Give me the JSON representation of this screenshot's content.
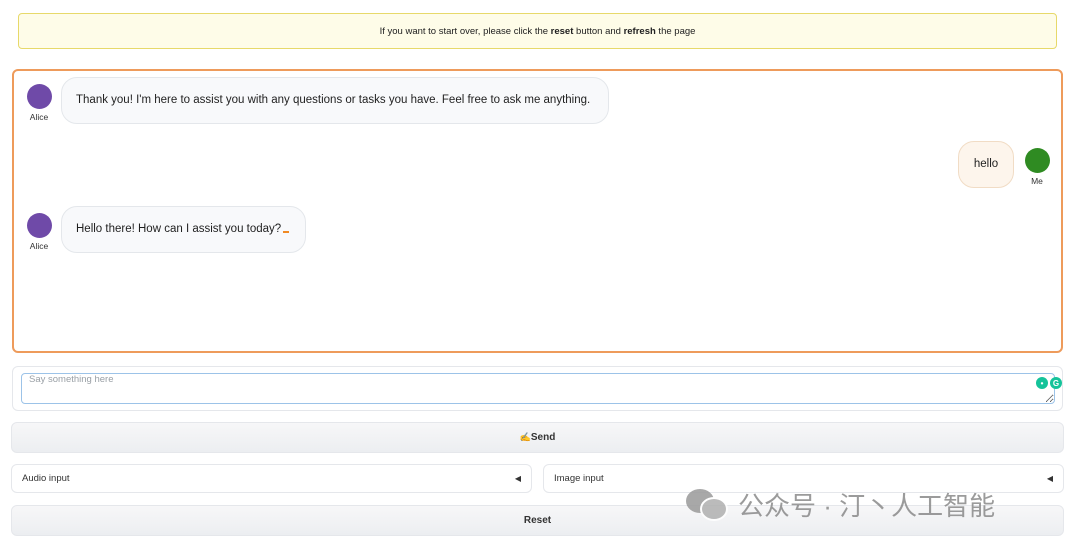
{
  "notice": {
    "prefix": "If you want to start over, please click the ",
    "reset_word": "reset",
    "middle": " button and ",
    "refresh_word": "refresh",
    "suffix": " the page"
  },
  "chat": {
    "messages": [
      {
        "sender": "Alice",
        "role": "bot",
        "text": "Thank you! I'm here to assist you with any questions or tasks you have. Feel free to ask me anything."
      },
      {
        "sender": "Me",
        "role": "user",
        "text": "hello"
      },
      {
        "sender": "Alice",
        "role": "bot",
        "text": "Hello there! How can I assist you today?"
      }
    ],
    "colors": {
      "alice_avatar": "#6f4aa8",
      "me_avatar": "#2f8b22",
      "border": "#ee9b5b"
    }
  },
  "input": {
    "placeholder": "Say something here",
    "value": "",
    "icons": [
      "grammarly-bulb-icon",
      "grammarly-g-icon"
    ]
  },
  "buttons": {
    "send_label": "Send",
    "send_icon": "✍️",
    "reset_label": "Reset"
  },
  "accordions": {
    "audio_label": "Audio input",
    "image_label": "Image input",
    "toggle_glyph": "◀"
  },
  "watermark": {
    "text": "公众号 · 汀丶人工智能",
    "icon": "wechat-icon"
  }
}
